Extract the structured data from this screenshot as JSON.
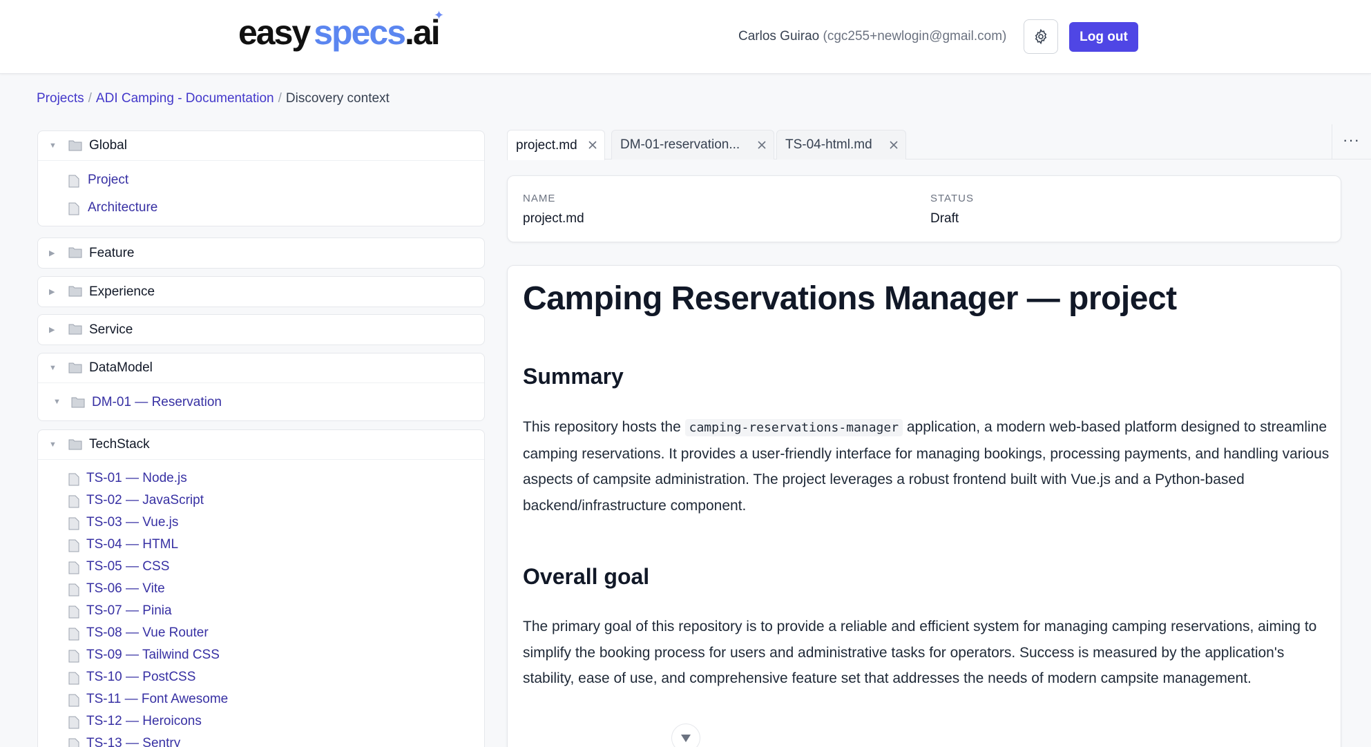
{
  "header": {
    "logo": {
      "part1": "easy",
      "part2": "specs",
      "part3": ".ai"
    },
    "user_name": "Carlos Guirao",
    "user_email": "(cgc255+newlogin@gmail.com)",
    "logout_label": "Log out"
  },
  "breadcrumb": {
    "projects": "Projects",
    "project": "ADI Camping - Documentation",
    "current": "Discovery context",
    "sep": "/"
  },
  "sidebar": {
    "global": {
      "label": "Global",
      "items": [
        "Project",
        "Architecture"
      ]
    },
    "feature": {
      "label": "Feature"
    },
    "experience": {
      "label": "Experience"
    },
    "service": {
      "label": "Service"
    },
    "datamodel": {
      "label": "DataModel",
      "items": [
        "DM-01 — Reservation"
      ]
    },
    "techstack": {
      "label": "TechStack",
      "items": [
        "TS-01 — Node.js",
        "TS-02 — JavaScript",
        "TS-03 — Vue.js",
        "TS-04 — HTML",
        "TS-05 — CSS",
        "TS-06 — Vite",
        "TS-07 — Pinia",
        "TS-08 — Vue Router",
        "TS-09 — Tailwind CSS",
        "TS-10 — PostCSS",
        "TS-11 — Font Awesome",
        "TS-12 — Heroicons",
        "TS-13 — Sentry"
      ]
    }
  },
  "tabs": [
    "project.md",
    "DM-01-reservation...",
    "TS-04-html.md"
  ],
  "tabs_more": "···",
  "meta": {
    "name_label": "NAME",
    "name_value": "project.md",
    "status_label": "STATUS",
    "status_value": "Draft"
  },
  "doc": {
    "title": "Camping Reservations Manager — project",
    "summary_heading": "Summary",
    "summary_pre": "This repository hosts the ",
    "summary_code": "camping-reservations-manager",
    "summary_post": " application, a modern web-based platform designed to streamline camping reservations. It provides a user-friendly interface for managing bookings, processing payments, and handling various aspects of campsite administration. The project leverages a robust frontend built with Vue.js and a Python-based backend/infrastructure component.",
    "goal_heading": "Overall goal",
    "goal_text": "The primary goal of this repository is to provide a reliable and efficient system for managing camping reservations, aiming to simplify the booking process for users and administrative tasks for operators. Success is measured by the application's stability, ease of use, and comprehensive feature set that addresses the needs of modern campsite management."
  }
}
